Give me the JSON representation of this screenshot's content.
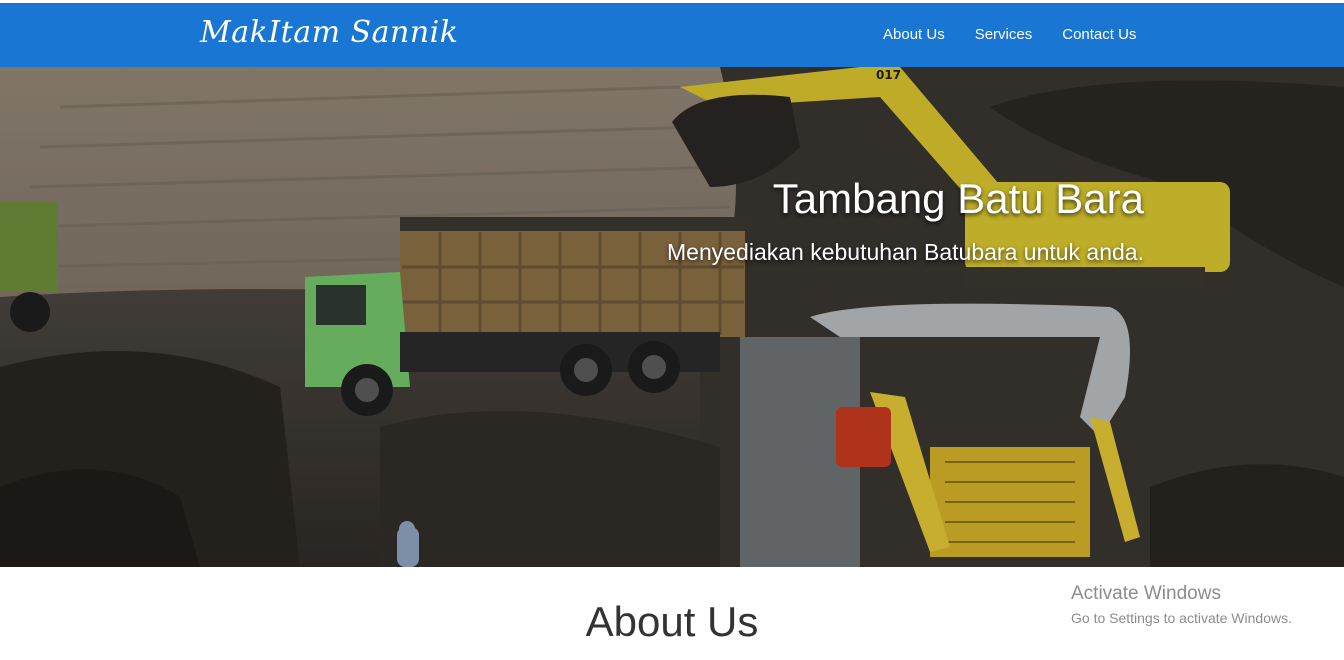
{
  "navbar": {
    "brand": "MakItam Sannik",
    "links": [
      "About Us",
      "Services",
      "Contact Us"
    ]
  },
  "hero": {
    "title": "Tambang Batu Bara",
    "subtitle": "Menyediakan kebutuhan Batubara untuk anda.",
    "excavator_number": "017"
  },
  "about": {
    "heading": "About Us"
  },
  "watermark": {
    "line1": "Activate Windows",
    "line2": "Go to Settings to activate Windows."
  },
  "colors": {
    "navbar": "#1976d2",
    "nav_text": "#ffffff"
  }
}
